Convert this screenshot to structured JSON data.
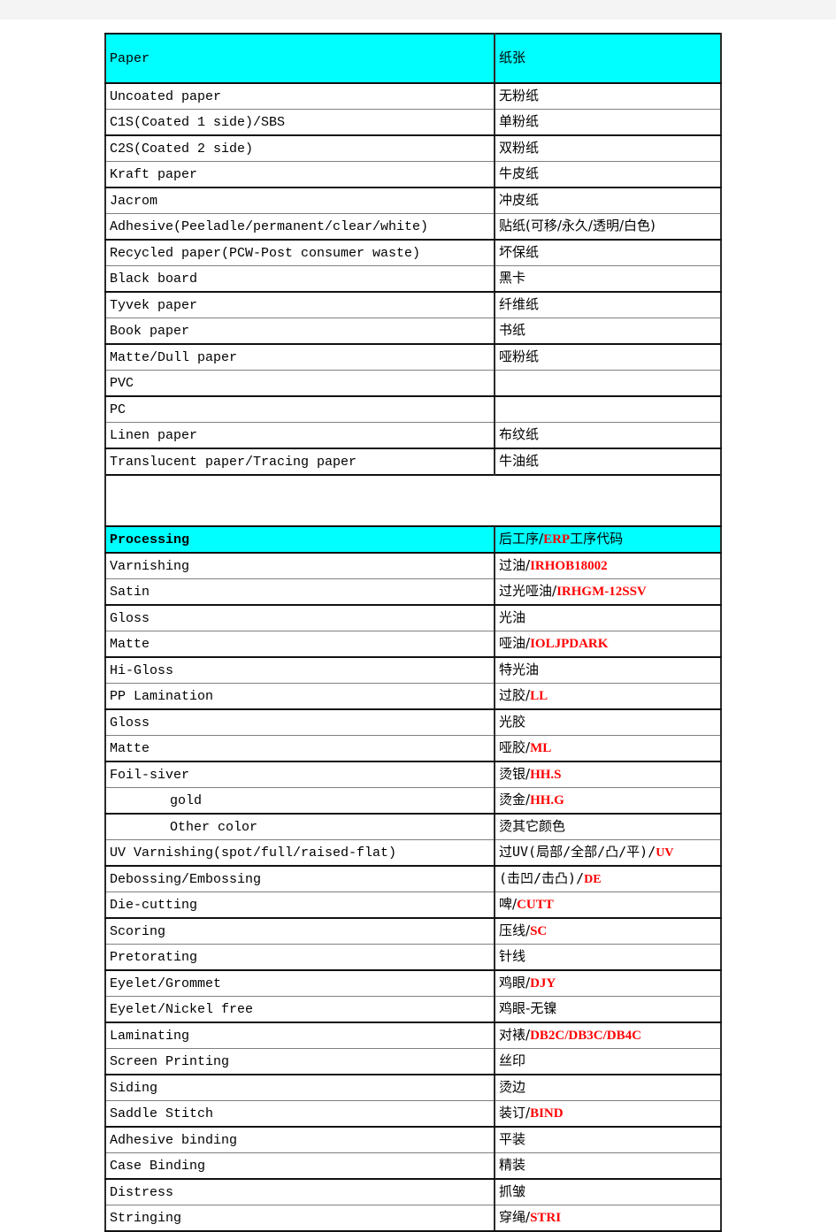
{
  "document": {
    "title": "Paper and Processing Terminology Table",
    "header_bg": "#00ffff",
    "code_color": "#ff0000",
    "text_color": "#000000"
  },
  "paper_section": {
    "header": {
      "en": "Paper",
      "zh": "纸张"
    },
    "rows": [
      {
        "en": "Uncoated paper",
        "zh": "无粉纸",
        "code": ""
      },
      {
        "en": "C1S(Coated 1 side)/SBS",
        "zh": "单粉纸",
        "code": ""
      },
      {
        "en": "C2S(Coated 2 side)",
        "zh": "双粉纸",
        "code": ""
      },
      {
        "en": "Kraft paper",
        "zh": "牛皮纸",
        "code": ""
      },
      {
        "en": "Jacrom",
        "zh": "冲皮纸",
        "code": ""
      },
      {
        "en": "Adhesive(Peeladle/permanent/clear/white)",
        "zh": "贴纸(可移/永久/透明/白色)",
        "code": ""
      },
      {
        "en": "Recycled paper(PCW-Post consumer waste)",
        "zh": "坏保纸",
        "code": ""
      },
      {
        "en": "Black board",
        "zh": "黑卡",
        "code": ""
      },
      {
        "en": "Tyvek paper",
        "zh": "纤维纸",
        "code": ""
      },
      {
        "en": "Book paper",
        "zh": "书纸",
        "code": ""
      },
      {
        "en": "Matte/Dull paper",
        "zh": "哑粉纸",
        "code": ""
      },
      {
        "en": "PVC",
        "zh": "",
        "code": ""
      },
      {
        "en": "PC",
        "zh": "",
        "code": ""
      },
      {
        "en": "Linen paper",
        "zh": "布纹纸",
        "code": ""
      },
      {
        "en": "Translucent paper/Tracing paper",
        "zh": "牛油纸",
        "code": ""
      }
    ]
  },
  "processing_section": {
    "header": {
      "en": "Processing",
      "zh": "后工序/",
      "zh_code": "ERP",
      "zh_tail": "工序代码"
    },
    "rows": [
      {
        "en": "Varnishing",
        "zh": "过油/",
        "code": "IRHOB18002",
        "indent": false,
        "mono": false
      },
      {
        "en": "Satin",
        "zh": "过光哑油/",
        "code": "IRHGM-12SSV",
        "indent": false,
        "mono": false
      },
      {
        "en": "Gloss",
        "zh": "光油",
        "code": "",
        "indent": false,
        "mono": false
      },
      {
        "en": "Matte",
        "zh": "哑油/",
        "code": "IOLJPDARK",
        "indent": false,
        "mono": false
      },
      {
        "en": "Hi-Gloss",
        "zh": "特光油",
        "code": "",
        "indent": false,
        "mono": false
      },
      {
        "en": "PP Lamination",
        "zh": "过胶/",
        "code": "LL",
        "indent": false,
        "mono": false
      },
      {
        "en": "Gloss",
        "zh": "光胶",
        "code": "",
        "indent": false,
        "mono": false
      },
      {
        "en": "Matte",
        "zh": "哑胶/",
        "code": "ML",
        "indent": false,
        "mono": false
      },
      {
        "en": "Foil-siver",
        "zh": "烫银/",
        "code": "HH.S",
        "indent": false,
        "mono": false
      },
      {
        "en": "gold",
        "zh": "烫金/",
        "code": "HH.G",
        "indent": true,
        "mono": false
      },
      {
        "en": "Other color",
        "zh": "烫其它颜色",
        "code": "",
        "indent": true,
        "mono": false
      },
      {
        "en": "UV Varnishing(spot/full/raised-flat)",
        "zh": "过UV(局部/全部/凸/平)/",
        "code": "UV",
        "indent": false,
        "mono": true
      },
      {
        "en": "Debossing/Embossing",
        "zh": "(击凹/击凸)/",
        "code": "DE",
        "indent": false,
        "mono": true
      },
      {
        "en": "Die-cutting",
        "zh": "啤/",
        "code": "CUTT",
        "indent": false,
        "mono": false
      },
      {
        "en": "Scoring",
        "zh": "压线/",
        "code": "SC",
        "indent": false,
        "mono": false
      },
      {
        "en": "Pretorating",
        "zh": "针线",
        "code": "",
        "indent": false,
        "mono": false
      },
      {
        "en": "Eyelet/Grommet",
        "zh": "鸡眼/",
        "code": "DJY",
        "indent": false,
        "mono": false
      },
      {
        "en": "Eyelet/Nickel free",
        "zh": "鸡眼-无镍",
        "code": "",
        "indent": false,
        "mono": false
      },
      {
        "en": "Laminating",
        "zh": "对裱/",
        "code": "DB2C/DB3C/DB4C",
        "indent": false,
        "mono": false
      },
      {
        "en": "Screen Printing",
        "zh": "丝印",
        "code": "",
        "indent": false,
        "mono": false
      },
      {
        "en": "Siding",
        "zh": "烫边",
        "code": "",
        "indent": false,
        "mono": false
      },
      {
        "en": "Saddle Stitch",
        "zh": "装订/",
        "code": "BIND",
        "indent": false,
        "mono": false
      },
      {
        "en": "Adhesive binding",
        "zh": "平装",
        "code": "",
        "indent": false,
        "mono": false
      },
      {
        "en": "Case Binding",
        "zh": "精装",
        "code": "",
        "indent": false,
        "mono": false
      },
      {
        "en": "Distress",
        "zh": "抓皱",
        "code": "",
        "indent": false,
        "mono": false
      },
      {
        "en": "Stringing",
        "zh": "穿绳/",
        "code": "STRI",
        "indent": false,
        "mono": false
      }
    ]
  }
}
